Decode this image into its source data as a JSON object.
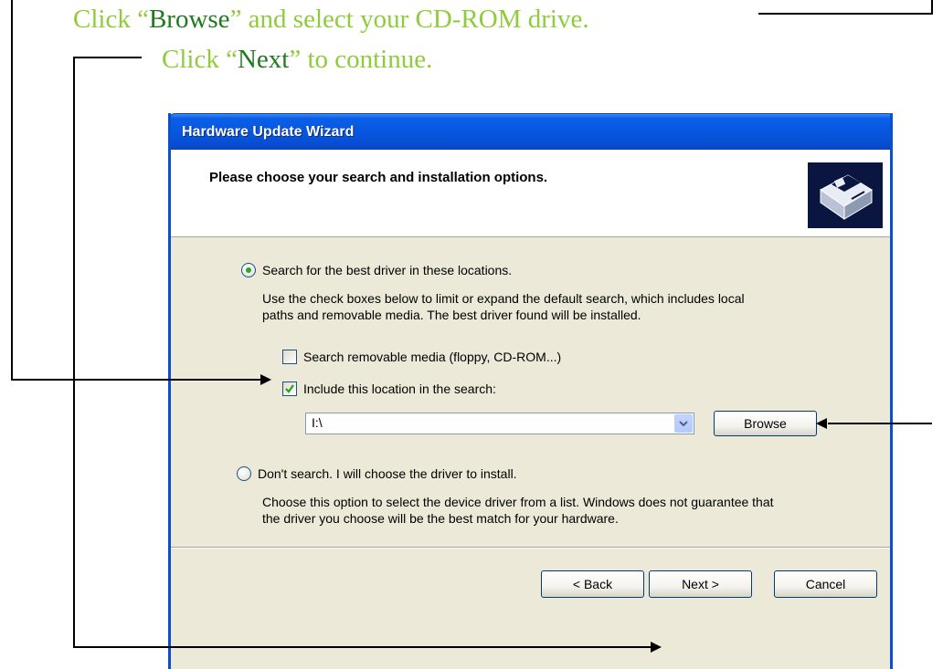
{
  "annotations": {
    "line1_pre": "Click “",
    "line1_kw": "Browse",
    "line1_post": "” and select your CD-ROM drive.",
    "line2_pre": "Click “",
    "line2_kw": "Next",
    "line2_post": "” to continue."
  },
  "window": {
    "title": "Hardware Update Wizard",
    "header_title": "Please choose your search and installation options."
  },
  "options": {
    "search_radio_label": "Search for the best driver in these locations.",
    "search_radio_checked": true,
    "search_description_1": "Use the check boxes below to limit or expand the default search, which includes local",
    "search_description_2": "paths and removable media. The best driver found will be installed.",
    "removable_checkbox_label": "Search removable media (floppy, CD-ROM...)",
    "removable_checked": false,
    "include_checkbox_label": "Include this location in the search:",
    "include_checked": true,
    "location_value": "I:\\",
    "browse_label": "Browse",
    "dont_search_radio_label": "Don't search. I will choose the driver to install.",
    "dont_search_description_1": "Choose this option to select the device driver from a list.  Windows does not guarantee that",
    "dont_search_description_2": "the driver you choose will be the best match for your hardware."
  },
  "footer": {
    "back_label": "< Back",
    "next_label": "Next >",
    "cancel_label": "Cancel"
  },
  "colors": {
    "annotation_text": "#8fcc3c",
    "annotation_keyword": "#1f7a1f",
    "titlebar": "#0858e0",
    "dialog_bg": "#ece9d8"
  }
}
